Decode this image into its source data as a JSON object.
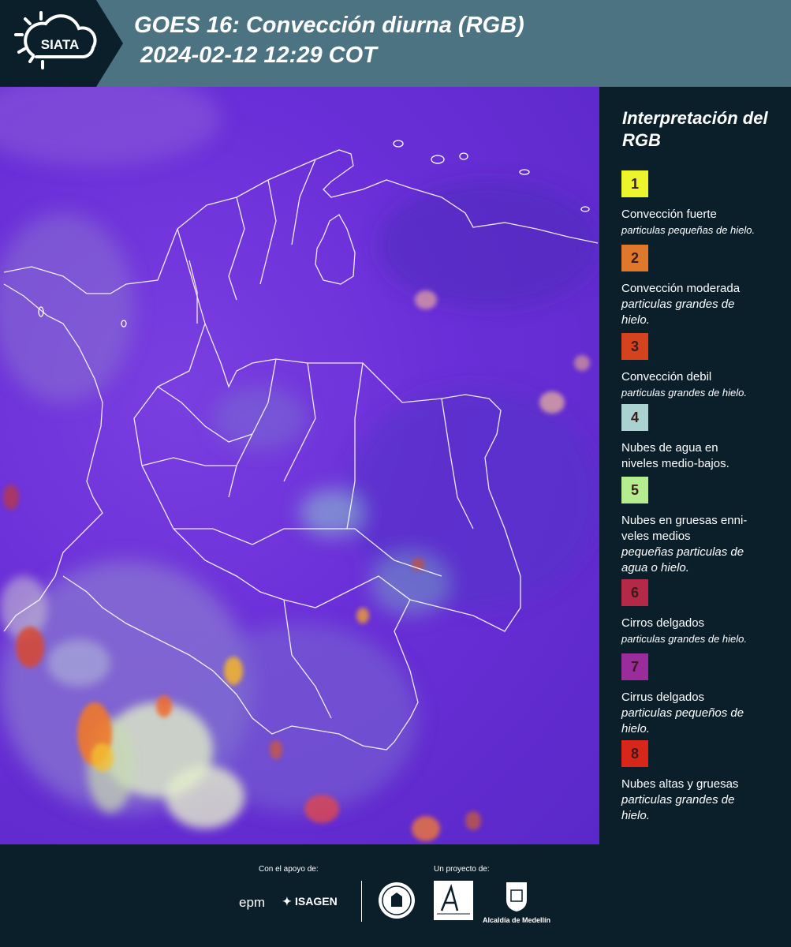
{
  "header": {
    "logo_text": "SIATA",
    "title_line1": "GOES 16: Convección diurna (RGB)",
    "title_line2": "2024-02-12 12:29 COT"
  },
  "legend": {
    "title": "Interpretación del RGB",
    "items": [
      {
        "num": "1",
        "color": "#ecf42c",
        "main": "Convección fuerte",
        "sub": "particulas pequeñas de hielo."
      },
      {
        "num": "2",
        "color": "#e0782c",
        "main": "Convección moderada",
        "sub": "particulas grandes de hielo."
      },
      {
        "num": "3",
        "color": "#d4421e",
        "main": "Convección debil",
        "sub": "particulas grandes de hielo."
      },
      {
        "num": "4",
        "color": "#a9d2d0",
        "main": "Nubes de agua en niveles medio-bajos.",
        "sub": ""
      },
      {
        "num": "5",
        "color": "#b6ec90",
        "main": "Nubes en gruesas enni-veles medios",
        "sub": "pequeñas particulas de agua o hielo."
      },
      {
        "num": "6",
        "color": "#b42848",
        "main": "Cirros delgados",
        "sub": "particulas grandes de hielo."
      },
      {
        "num": "7",
        "color": "#9a2c9c",
        "main": "Cirrus delgados",
        "sub": "particulas pequeños de hielo."
      },
      {
        "num": "8",
        "color": "#d8261a",
        "main": "Nubes altas y gruesas",
        "sub": "particulas grandes de hielo."
      }
    ]
  },
  "footer": {
    "support_label": "Con el apoyo de:",
    "project_label": "Un proyecto de:",
    "sponsor_epm": "epm",
    "sponsor_isagen": "ISAGEN",
    "alcaldia": "Alcaldía de Medellín"
  }
}
